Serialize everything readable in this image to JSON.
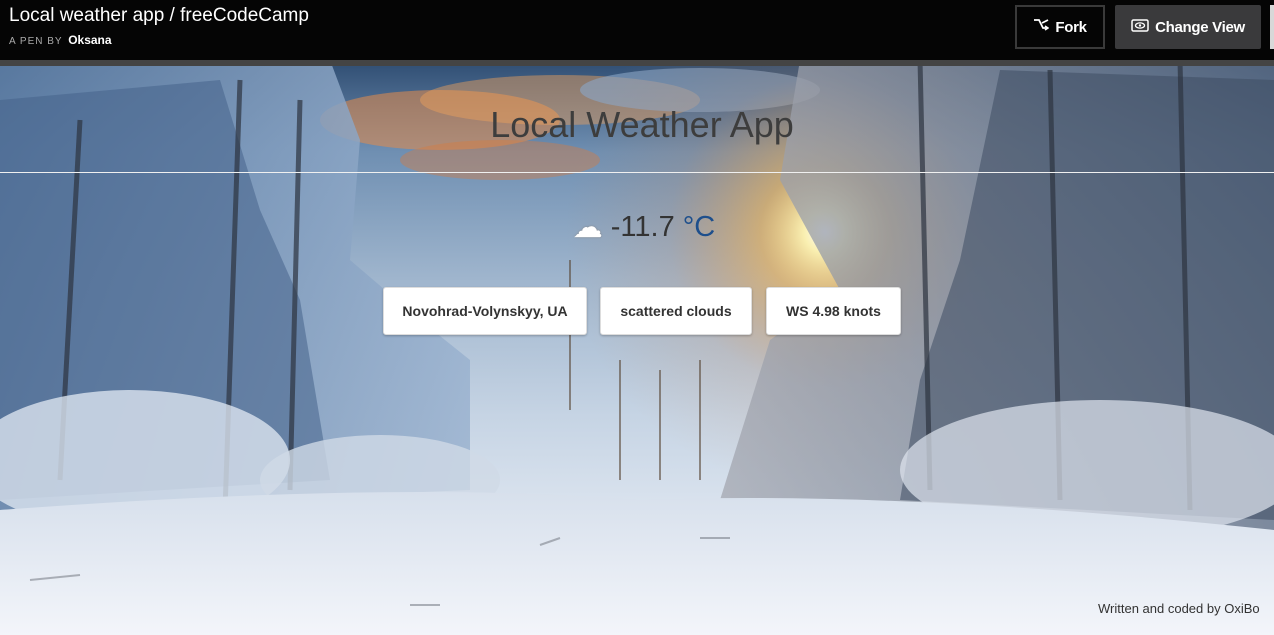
{
  "header": {
    "title": "Local weather app / freeCodeCamp",
    "by_prefix": "A PEN BY",
    "author": "Oksana",
    "fork_label": "Fork",
    "change_view_label": "Change View"
  },
  "app": {
    "title": "Local Weather App",
    "weather_icon": "cloud-icon",
    "temperature": "-11.7",
    "unit": "°C",
    "location": "Novohrad-Volynskyy, UA",
    "description": "scattered clouds",
    "wind": "WS 4.98 knots",
    "credit": "Written and coded by OxiBo"
  },
  "icons": {
    "fork": "fork-icon",
    "change_view": "eye-icon"
  }
}
